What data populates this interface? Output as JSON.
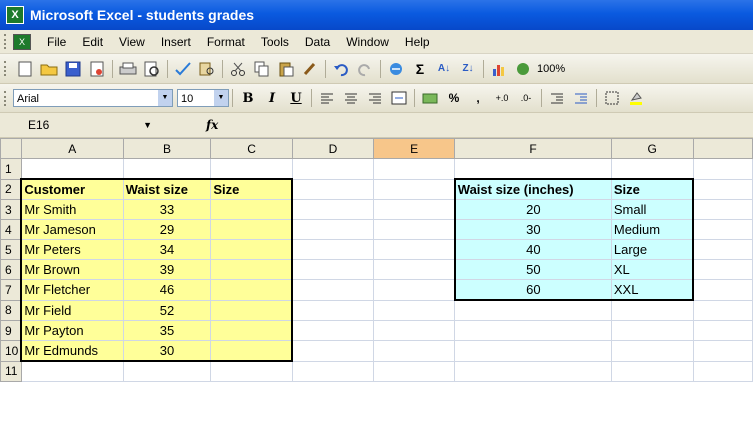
{
  "window": {
    "title": "Microsoft Excel - students grades"
  },
  "menu": [
    "File",
    "Edit",
    "View",
    "Insert",
    "Format",
    "Tools",
    "Data",
    "Window",
    "Help"
  ],
  "toolbar": {
    "zoom": "100%"
  },
  "formatting": {
    "font": "Arial",
    "size": "10",
    "bold": "B",
    "italic": "I",
    "underline": "U",
    "percent": "%",
    "comma": ","
  },
  "formula_bar": {
    "name_box": "E16",
    "fx": "fx",
    "value": ""
  },
  "sheet": {
    "columns": [
      "A",
      "B",
      "C",
      "D",
      "E",
      "F",
      "G"
    ],
    "selected_column": "E",
    "rows": [
      {
        "n": "1",
        "a": "",
        "b": "",
        "c": "",
        "f": "",
        "g": ""
      },
      {
        "n": "2",
        "a": "Customer",
        "b": "Waist size",
        "c": "Size",
        "f": "Waist size (inches)",
        "g": "Size"
      },
      {
        "n": "3",
        "a": "Mr Smith",
        "b": "33",
        "c": "",
        "f": "20",
        "g": "Small"
      },
      {
        "n": "4",
        "a": "Mr Jameson",
        "b": "29",
        "c": "",
        "f": "30",
        "g": "Medium"
      },
      {
        "n": "5",
        "a": "Mr Peters",
        "b": "34",
        "c": "",
        "f": "40",
        "g": "Large"
      },
      {
        "n": "6",
        "a": "Mr Brown",
        "b": "39",
        "c": "",
        "f": "50",
        "g": "XL"
      },
      {
        "n": "7",
        "a": "Mr Fletcher",
        "b": "46",
        "c": "",
        "f": "60",
        "g": "XXL"
      },
      {
        "n": "8",
        "a": "Mr Field",
        "b": "52",
        "c": "",
        "f": "",
        "g": ""
      },
      {
        "n": "9",
        "a": "Mr Payton",
        "b": "35",
        "c": "",
        "f": "",
        "g": ""
      },
      {
        "n": "10",
        "a": "Mr Edmunds",
        "b": "30",
        "c": "",
        "f": "",
        "g": ""
      },
      {
        "n": "11",
        "a": "",
        "b": "",
        "c": "",
        "f": "",
        "g": ""
      }
    ]
  }
}
